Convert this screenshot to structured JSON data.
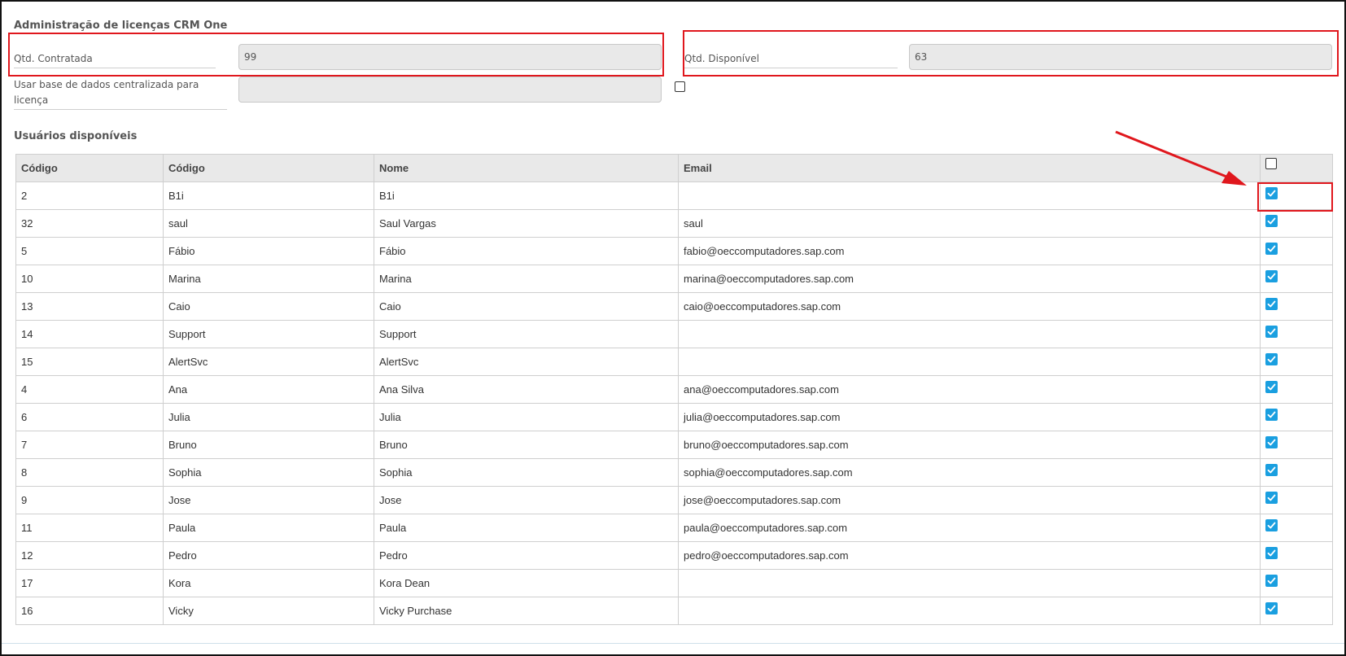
{
  "form": {
    "section_title": "Administração de licenças CRM One",
    "qtd_contratada": {
      "label": "Qtd. Contratada",
      "value": "99"
    },
    "qtd_disponivel": {
      "label": "Qtd. Disponível",
      "value": "63"
    },
    "usar_base": {
      "label": "Usar base de dados centralizada para licença",
      "value": "",
      "checked": false
    }
  },
  "users": {
    "section_title": "Usuários disponíveis",
    "columns": [
      "Código",
      "Código",
      "Nome",
      "Email"
    ],
    "select_all_checked": false,
    "rows": [
      {
        "code": "2",
        "user_code": "B1i",
        "name": "B1i",
        "email": "",
        "checked": true
      },
      {
        "code": "32",
        "user_code": "saul",
        "name": "Saul Vargas",
        "email": "saul",
        "checked": true
      },
      {
        "code": "5",
        "user_code": "Fábio",
        "name": "Fábio",
        "email": "fabio@oeccomputadores.sap.com",
        "checked": true
      },
      {
        "code": "10",
        "user_code": "Marina",
        "name": "Marina",
        "email": "marina@oeccomputadores.sap.com",
        "checked": true
      },
      {
        "code": "13",
        "user_code": "Caio",
        "name": "Caio",
        "email": "caio@oeccomputadores.sap.com",
        "checked": true
      },
      {
        "code": "14",
        "user_code": "Support",
        "name": "Support",
        "email": "",
        "checked": true
      },
      {
        "code": "15",
        "user_code": "AlertSvc",
        "name": "AlertSvc",
        "email": "",
        "checked": true
      },
      {
        "code": "4",
        "user_code": "Ana",
        "name": "Ana Silva",
        "email": "ana@oeccomputadores.sap.com",
        "checked": true
      },
      {
        "code": "6",
        "user_code": "Julia",
        "name": "Julia",
        "email": "julia@oeccomputadores.sap.com",
        "checked": true
      },
      {
        "code": "7",
        "user_code": "Bruno",
        "name": "Bruno",
        "email": "bruno@oeccomputadores.sap.com",
        "checked": true
      },
      {
        "code": "8",
        "user_code": "Sophia",
        "name": "Sophia",
        "email": "sophia@oeccomputadores.sap.com",
        "checked": true
      },
      {
        "code": "9",
        "user_code": "Jose",
        "name": "Jose",
        "email": "jose@oeccomputadores.sap.com",
        "checked": true
      },
      {
        "code": "11",
        "user_code": "Paula",
        "name": "Paula",
        "email": "paula@oeccomputadores.sap.com",
        "checked": true
      },
      {
        "code": "12",
        "user_code": "Pedro",
        "name": "Pedro",
        "email": "pedro@oeccomputadores.sap.com",
        "checked": true
      },
      {
        "code": "17",
        "user_code": "Kora",
        "name": "Kora Dean",
        "email": "",
        "checked": true
      },
      {
        "code": "16",
        "user_code": "Vicky",
        "name": "Vicky Purchase",
        "email": "",
        "checked": true
      }
    ]
  },
  "colors": {
    "highlight": "#e0171d",
    "checkbox_accent": "#1a9fe0"
  }
}
